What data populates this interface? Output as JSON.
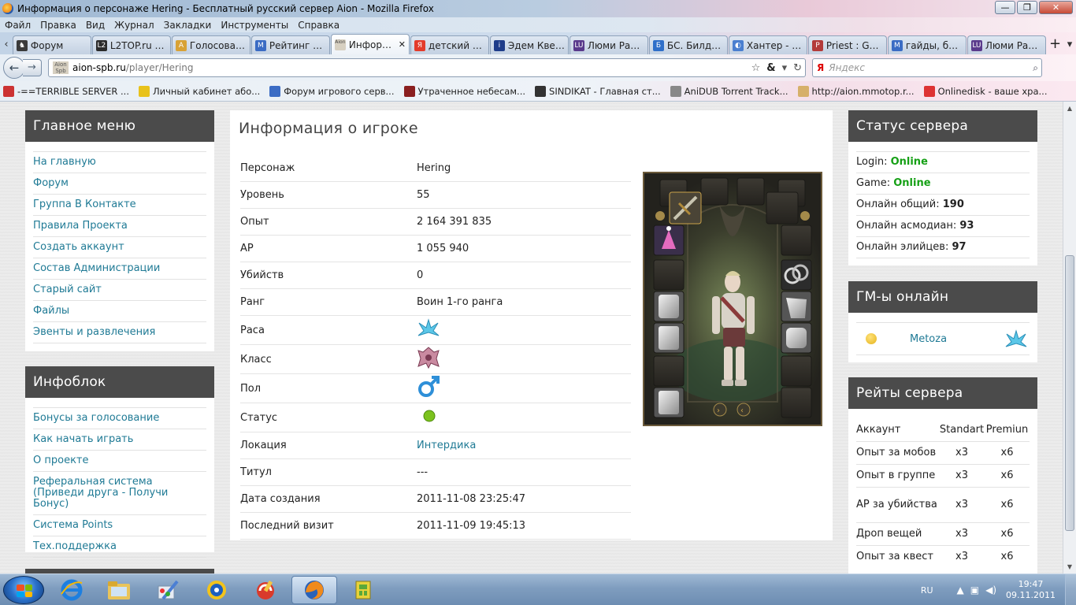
{
  "window": {
    "title": "Информация о персонаже Hering - Бесплатный русский сервер Aion - Mozilla Firefox"
  },
  "menubar": [
    "Файл",
    "Правка",
    "Вид",
    "Журнал",
    "Закладки",
    "Инструменты",
    "Справка"
  ],
  "tabs": [
    {
      "label": "Форум",
      "color": "#3a3a3a",
      "glyph": "♞"
    },
    {
      "label": "L2TOP.ru —...",
      "color": "#2b2b2b",
      "glyph": "L2"
    },
    {
      "label": "Голосован...",
      "color": "#d8a236",
      "glyph": "A"
    },
    {
      "label": "Рейтинг се...",
      "color": "#3b6cc4",
      "glyph": "M"
    },
    {
      "label": "Информ...",
      "color": "#d7d0c1",
      "glyph": "Aion",
      "active": true
    },
    {
      "label": "детский сти...",
      "color": "#e33b2b",
      "glyph": "Я"
    },
    {
      "label": "Эдем Квест ...",
      "color": "#1f3d8a",
      "glyph": "i"
    },
    {
      "label": "Люми Рагн...",
      "color": "#5a3a8c",
      "glyph": "LU"
    },
    {
      "label": "БС. Билды ...",
      "color": "#2f6fc9",
      "glyph": "Б"
    },
    {
      "label": "Хантер - Би...",
      "color": "#4a7fd0",
      "glyph": "◐"
    },
    {
      "label": "Priest : Guid...",
      "color": "#b33a3a",
      "glyph": "P"
    },
    {
      "label": "гайды, бил...",
      "color": "#3b6cc4",
      "glyph": "M"
    },
    {
      "label": "Люми Раг...",
      "color": "#5a3a8c",
      "glyph": "LU"
    }
  ],
  "addressbar": {
    "host": "aion-spb.ru",
    "path": "/player/Hering",
    "site_badge": "Aion Spb"
  },
  "searchbar": {
    "engine": "Я",
    "placeholder": "Яндекс"
  },
  "bookmarks": [
    {
      "label": "-==TERRIBLE SERVER ...",
      "color": "#c33"
    },
    {
      "label": "Личный кабинет або...",
      "color": "#e8c21b"
    },
    {
      "label": "Форум игрового серв...",
      "color": "#3b6cc4"
    },
    {
      "label": "Утраченное небесам...",
      "color": "#8a1f1f"
    },
    {
      "label": "SINDIKAT - Главная ст...",
      "color": "#333"
    },
    {
      "label": "AniDUB Torrent Track...",
      "color": "#888"
    },
    {
      "label": "http://aion.mmotop.r...",
      "color": "#d6b06a"
    },
    {
      "label": "Onlinedisk - ваше хра...",
      "color": "#d33"
    }
  ],
  "left": {
    "main_menu": {
      "title": "Главное меню",
      "items": [
        "На главную",
        "Форум",
        "Группа В Контакте",
        "Правила Проекта",
        "Создать аккаунт",
        "Состав Администрации",
        "Старый сайт",
        "Файлы",
        "Эвенты и развлечения"
      ]
    },
    "infoblock": {
      "title": "Инфоблок",
      "items": [
        "Бонусы за голосование",
        "Как начать играть",
        "О проекте",
        "Реферальная система (Приведи друга - Получи Бонус)",
        "Система Points",
        "Тех.поддержка"
      ]
    }
  },
  "main": {
    "title": "Информация о игроке",
    "rows": [
      {
        "label": "Персонаж",
        "value": "Hering"
      },
      {
        "label": "Уровень",
        "value": "55"
      },
      {
        "label": "Опыт",
        "value": "2 164 391 835"
      },
      {
        "label": "AP",
        "value": "1 055 940"
      },
      {
        "label": "Убийств",
        "value": "0"
      },
      {
        "label": "Ранг",
        "value": "Воин 1-го ранга"
      },
      {
        "label": "Раса",
        "value": "",
        "icon": "elyos-race-icon"
      },
      {
        "label": "Класс",
        "value": "",
        "icon": "class-icon"
      },
      {
        "label": "Пол",
        "value": "",
        "icon": "male-gender-icon"
      },
      {
        "label": "Статус",
        "value": "",
        "icon": "online-status-icon"
      },
      {
        "label": "Локация",
        "value": "Интердика"
      },
      {
        "label": "Титул",
        "value": "---"
      },
      {
        "label": "Дата создания",
        "value": "2011-11-08 23:25:47"
      },
      {
        "label": "Последний визит",
        "value": "2011-11-09 19:45:13"
      }
    ]
  },
  "right": {
    "server_status": {
      "title": "Статус сервера",
      "login_label": "Login:",
      "login_value": "Online",
      "game_label": "Game:",
      "game_value": "Online",
      "total_label": "Онлайн общий:",
      "total_value": "190",
      "asmo_label": "Онлайн асмодиан:",
      "asmo_value": "93",
      "elyos_label": "Онлайн элийцев:",
      "elyos_value": "97"
    },
    "gm_online": {
      "title": "ГМ-ы онлайн",
      "name": "Metoza"
    },
    "rates": {
      "title": "Рейты сервера",
      "headers": [
        "Аккаунт",
        "Standart",
        "Premiun"
      ],
      "rows": [
        {
          "name": "Опыт за мобов",
          "std": "x3",
          "prem": "x6"
        },
        {
          "name": "Опыт в группе",
          "std": "x3",
          "prem": "x6"
        },
        {
          "name": "AP за убийства",
          "std": "x3",
          "prem": "x6"
        },
        {
          "name": "Дроп вещей",
          "std": "x3",
          "prem": "x6"
        },
        {
          "name": "Опыт за квест",
          "std": "x3",
          "prem": "x6"
        }
      ]
    }
  },
  "taskbar": {
    "lang": "RU",
    "time": "19:47",
    "date": "09.11.2011"
  }
}
